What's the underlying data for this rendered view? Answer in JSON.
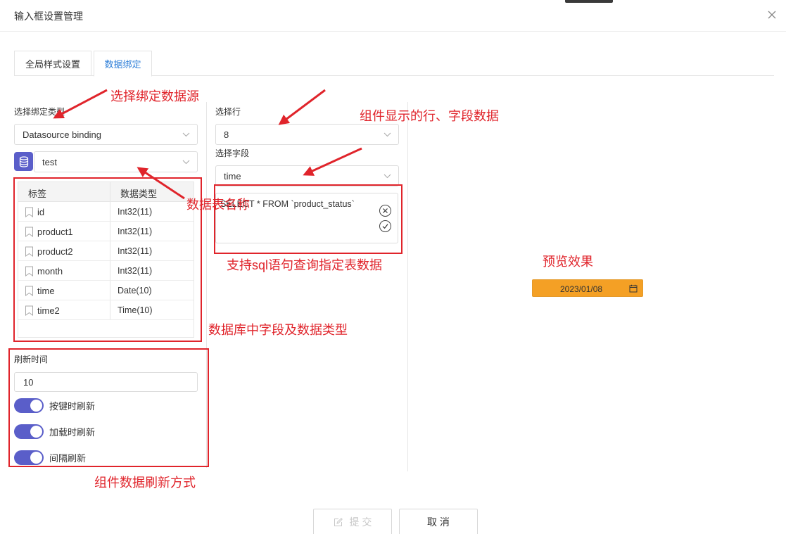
{
  "dialog": {
    "title": "输入框设置管理"
  },
  "tabs": [
    {
      "label": "全局样式设置"
    },
    {
      "label": "数据绑定"
    }
  ],
  "binding": {
    "type_label": "选择绑定类型",
    "type_value": "Datasource binding",
    "table_value": "test",
    "fields_header": {
      "name": "标签",
      "type": "数据类型"
    },
    "fields": [
      {
        "name": "id",
        "type": "Int32(11)"
      },
      {
        "name": "product1",
        "type": "Int32(11)"
      },
      {
        "name": "product2",
        "type": "Int32(11)"
      },
      {
        "name": "month",
        "type": "Int32(11)"
      },
      {
        "name": "time",
        "type": "Date(10)"
      },
      {
        "name": "time2",
        "type": "Time(10)"
      }
    ]
  },
  "refresh": {
    "label": "刷新时间",
    "value": "10",
    "toggles": [
      {
        "label": "按键时刷新",
        "on": true
      },
      {
        "label": "加载时刷新",
        "on": true
      },
      {
        "label": "间隔刷新",
        "on": true
      }
    ]
  },
  "row_field": {
    "row_label": "选择行",
    "row_value": "8",
    "field_label": "选择字段",
    "field_value": "time",
    "sql_text": "SELECT * FROM `product_status`"
  },
  "preview": {
    "date": "2023/01/08"
  },
  "footer": {
    "submit": "提 交",
    "cancel": "取 消"
  },
  "annotations": {
    "binding_source": "选择绑定数据源",
    "row_field_data": "组件显示的行、字段数据",
    "table_name": "数据表名称",
    "sql_support": "支持sql语句查询指定表数据",
    "preview": "预览效果",
    "db_fields": "数据库中字段及数据类型",
    "refresh_mode": "组件数据刷新方式"
  },
  "colors": {
    "accent": "#5a5ec9",
    "tab_active": "#2f7fd8",
    "annotation": "#e0242b",
    "preview_bg": "#f4a025"
  }
}
